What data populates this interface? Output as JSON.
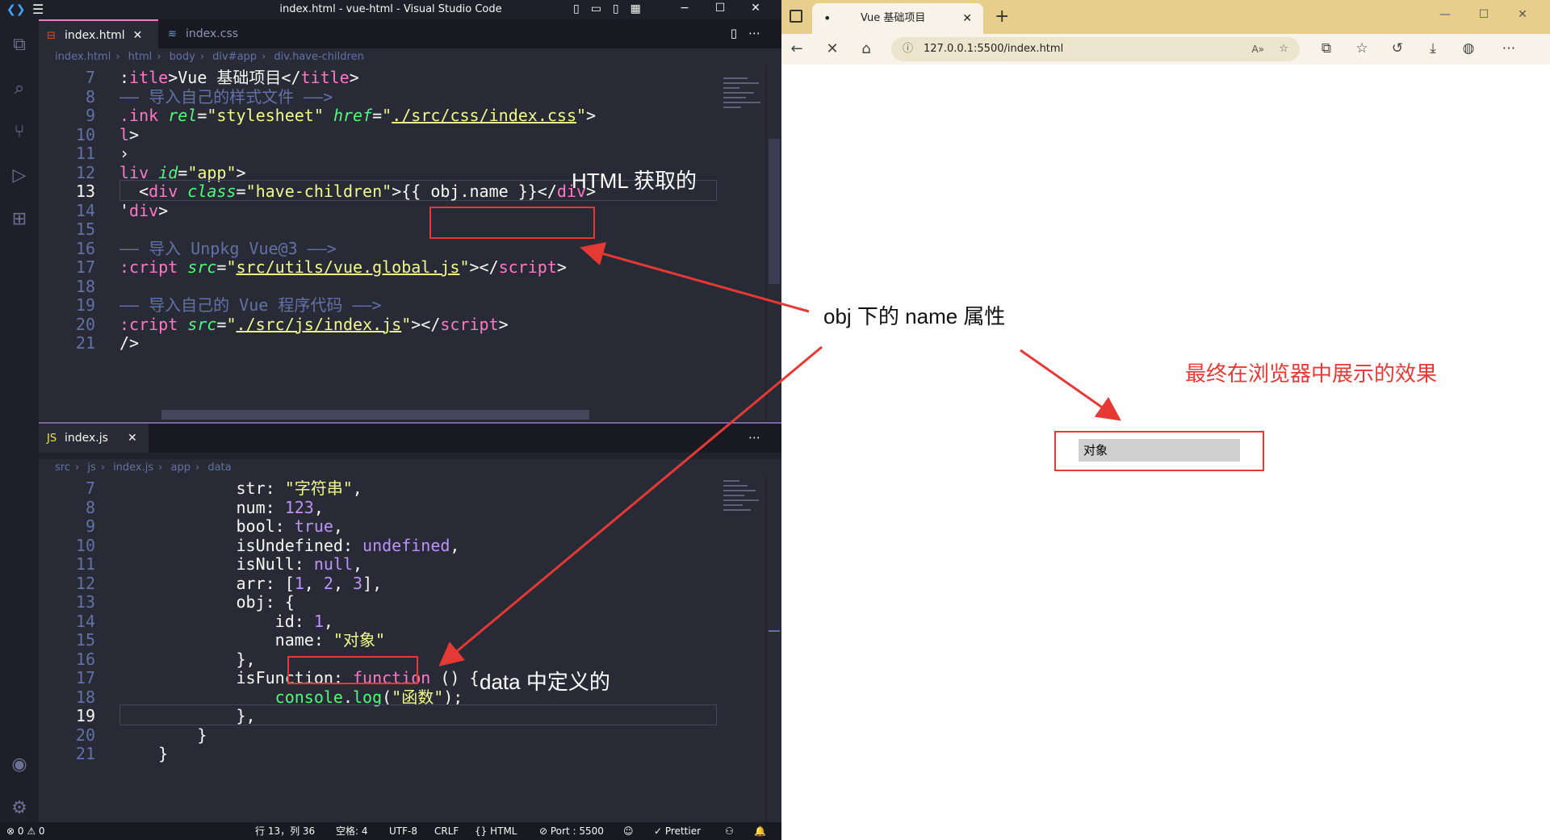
{
  "vscode": {
    "window_title": "index.html - vue-html - Visual Studio Code",
    "tabs_top": [
      {
        "label": "index.html",
        "active": true
      },
      {
        "label": "index.css",
        "active": false
      }
    ],
    "breadcrumb_top": [
      "index.html",
      "html",
      "body",
      "div#app",
      "div.have-children"
    ],
    "top_lines": [
      {
        "n": "7",
        "parts": [
          [
            "c-punct",
            ":"
          ],
          [
            "c-tag",
            "itle"
          ],
          [
            "c-punct",
            ">Vue 基础项目</"
          ],
          [
            "c-tag",
            "title"
          ],
          [
            "c-punct",
            ">"
          ]
        ]
      },
      {
        "n": "8",
        "parts": [
          [
            "c-comment",
            "—— 导入自己的样式文件 ——>"
          ]
        ]
      },
      {
        "n": "9",
        "parts": [
          [
            "c-tag",
            ".ink "
          ],
          [
            "c-attr",
            "rel"
          ],
          [
            "c-punct",
            "="
          ],
          [
            "c-str",
            "\"stylesheet\" "
          ],
          [
            "c-attr",
            "href"
          ],
          [
            "c-punct",
            "="
          ],
          [
            "c-str",
            "\""
          ],
          [
            "c-str-u",
            "./src/css/index.css"
          ],
          [
            "c-str",
            "\""
          ],
          [
            "c-punct",
            ">"
          ]
        ]
      },
      {
        "n": "10",
        "parts": [
          [
            "c-tag",
            "l"
          ],
          [
            "c-punct",
            ">"
          ]
        ]
      },
      {
        "n": "11",
        "parts": [
          [
            "c-punct",
            "›"
          ]
        ]
      },
      {
        "n": "12",
        "parts": [
          [
            "c-tag",
            "liv "
          ],
          [
            "c-attr",
            "id"
          ],
          [
            "c-punct",
            "="
          ],
          [
            "c-str",
            "\"app\""
          ],
          [
            "c-punct",
            ">"
          ]
        ]
      },
      {
        "n": "13",
        "parts": [
          [
            "c-punct",
            "  <"
          ],
          [
            "c-tag",
            "div "
          ],
          [
            "c-attr",
            "class"
          ],
          [
            "c-punct",
            "="
          ],
          [
            "c-str",
            "\"have-children\""
          ],
          [
            "c-punct",
            ">{{ obj.name }}</"
          ],
          [
            "c-tag",
            "div"
          ],
          [
            "c-punct",
            ">"
          ]
        ],
        "current": true
      },
      {
        "n": "14",
        "parts": [
          [
            "c-punct",
            "'"
          ],
          [
            "c-tag",
            "div"
          ],
          [
            "c-punct",
            ">"
          ]
        ]
      },
      {
        "n": "15",
        "parts": []
      },
      {
        "n": "16",
        "parts": [
          [
            "c-comment",
            "—— 导入 Unpkg Vue@3 ——>"
          ]
        ]
      },
      {
        "n": "17",
        "parts": [
          [
            "c-tag",
            ":cript "
          ],
          [
            "c-attr",
            "src"
          ],
          [
            "c-punct",
            "="
          ],
          [
            "c-str",
            "\""
          ],
          [
            "c-str-u",
            "src/utils/vue.global.js"
          ],
          [
            "c-str",
            "\""
          ],
          [
            "c-punct",
            "></"
          ],
          [
            "c-tag",
            "script"
          ],
          [
            "c-punct",
            ">"
          ]
        ]
      },
      {
        "n": "18",
        "parts": []
      },
      {
        "n": "19",
        "parts": [
          [
            "c-comment",
            "—— 导入自己的 Vue 程序代码 ——>"
          ]
        ]
      },
      {
        "n": "20",
        "parts": [
          [
            "c-tag",
            ":cript "
          ],
          [
            "c-attr",
            "src"
          ],
          [
            "c-punct",
            "="
          ],
          [
            "c-str",
            "\""
          ],
          [
            "c-str-u",
            "./src/js/index.js"
          ],
          [
            "c-str",
            "\""
          ],
          [
            "c-punct",
            "></"
          ],
          [
            "c-tag",
            "script"
          ],
          [
            "c-punct",
            ">"
          ]
        ]
      },
      {
        "n": "21",
        "parts": [
          [
            "c-punct",
            "/>"
          ]
        ]
      }
    ],
    "tabs_bottom": [
      {
        "label": "index.js"
      }
    ],
    "breadcrumb_bottom": [
      "src",
      "js",
      "index.js",
      "app",
      "data"
    ],
    "bottom_lines": [
      {
        "n": "7",
        "parts": [
          [
            "c-punct",
            "            str: "
          ],
          [
            "c-str",
            "\"字符串\""
          ],
          [
            "c-punct",
            ","
          ]
        ]
      },
      {
        "n": "8",
        "parts": [
          [
            "c-punct",
            "            num: "
          ],
          [
            "c-num",
            "123"
          ],
          [
            "c-punct",
            ","
          ]
        ]
      },
      {
        "n": "9",
        "parts": [
          [
            "c-punct",
            "            bool: "
          ],
          [
            "c-kw",
            "true"
          ],
          [
            "c-punct",
            ","
          ]
        ]
      },
      {
        "n": "10",
        "parts": [
          [
            "c-punct",
            "            isUndefined: "
          ],
          [
            "c-kw",
            "undefined"
          ],
          [
            "c-punct",
            ","
          ]
        ]
      },
      {
        "n": "11",
        "parts": [
          [
            "c-punct",
            "            isNull: "
          ],
          [
            "c-kw",
            "null"
          ],
          [
            "c-punct",
            ","
          ]
        ]
      },
      {
        "n": "12",
        "parts": [
          [
            "c-punct",
            "            arr: ["
          ],
          [
            "c-num",
            "1"
          ],
          [
            "c-punct",
            ", "
          ],
          [
            "c-num",
            "2"
          ],
          [
            "c-punct",
            ", "
          ],
          [
            "c-num",
            "3"
          ],
          [
            "c-punct",
            "],"
          ]
        ]
      },
      {
        "n": "13",
        "parts": [
          [
            "c-punct",
            "            obj: {"
          ]
        ]
      },
      {
        "n": "14",
        "parts": [
          [
            "c-punct",
            "                id: "
          ],
          [
            "c-num",
            "1"
          ],
          [
            "c-punct",
            ","
          ]
        ]
      },
      {
        "n": "15",
        "parts": [
          [
            "c-punct",
            "                name: "
          ],
          [
            "c-str",
            "\"对象\""
          ]
        ]
      },
      {
        "n": "16",
        "parts": [
          [
            "c-punct",
            "            },"
          ]
        ]
      },
      {
        "n": "17",
        "parts": [
          [
            "c-punct",
            "            isFunction: "
          ],
          [
            "c-tag",
            "function"
          ],
          [
            "c-punct",
            " () {"
          ]
        ]
      },
      {
        "n": "18",
        "parts": [
          [
            "c-punct",
            "                "
          ],
          [
            "c-fn",
            "console"
          ],
          [
            "c-punct",
            "."
          ],
          [
            "c-fn",
            "log"
          ],
          [
            "c-punct",
            "("
          ],
          [
            "c-str",
            "\"函数\""
          ],
          [
            "c-punct",
            ");"
          ]
        ]
      },
      {
        "n": "19",
        "parts": [
          [
            "c-punct",
            "            },"
          ]
        ],
        "current": true
      },
      {
        "n": "20",
        "parts": [
          [
            "c-punct",
            "        }"
          ]
        ]
      },
      {
        "n": "21",
        "parts": [
          [
            "c-punct",
            "    }"
          ]
        ]
      }
    ],
    "status": {
      "problems": "⊗ 0 ⚠ 0",
      "cursor": "行 13，列 36",
      "spaces": "空格: 4",
      "encoding": "UTF-8",
      "eol": "CRLF",
      "language": "{} HTML",
      "port": "⊘ Port : 5500",
      "prettier": "✓ Prettier"
    }
  },
  "browser": {
    "tab_title": "Vue 基础项目",
    "url": "127.0.0.1:5500/index.html",
    "rendered_text": "对象"
  },
  "annotations": {
    "html_label": "HTML 获取的",
    "obj_label": "obj 下的 name 属性",
    "data_label": "data 中定义的",
    "browser_label": "最终在浏览器中展示的效果",
    "accent_red": "#e53935"
  }
}
